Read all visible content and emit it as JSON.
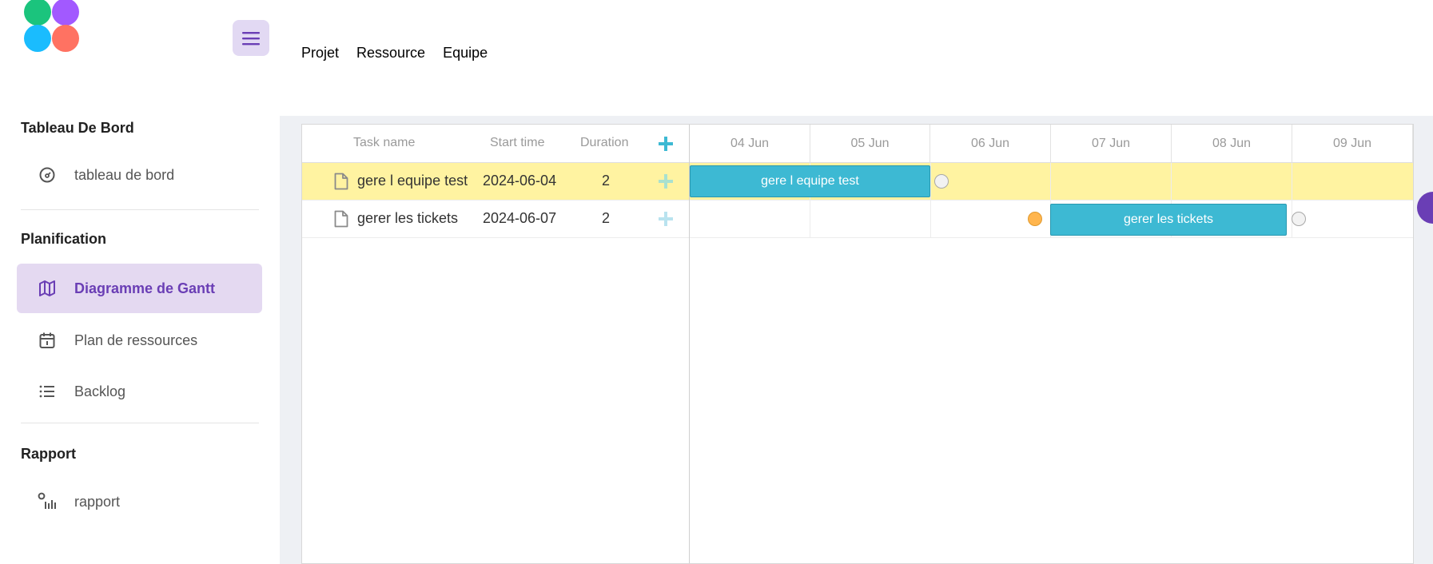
{
  "header": {
    "menu_icon": "hamburger-icon",
    "nav": [
      "Projet",
      "Ressource",
      "Equipe"
    ]
  },
  "sidebar": {
    "sections": [
      {
        "title": "Tableau De Bord",
        "items": [
          {
            "label": "tableau de bord",
            "icon": "dashboard-icon"
          }
        ]
      },
      {
        "title": "Planification",
        "items": [
          {
            "label": "Diagramme de Gantt",
            "icon": "map-icon",
            "active": true
          },
          {
            "label": "Plan de ressources",
            "icon": "calendar-icon"
          },
          {
            "label": "Backlog",
            "icon": "list-icon"
          }
        ]
      },
      {
        "title": "Rapport",
        "items": [
          {
            "label": "rapport",
            "icon": "report-icon"
          }
        ]
      }
    ]
  },
  "gantt": {
    "columns": {
      "task": "Task name",
      "start": "Start time",
      "duration": "Duration"
    },
    "scale": [
      "04 Jun",
      "05 Jun",
      "06 Jun",
      "07 Jun",
      "08 Jun",
      "09 Jun"
    ],
    "tasks": [
      {
        "name": "gere l equipe test",
        "start": "2024-06-04",
        "duration": "2",
        "selected": true
      },
      {
        "name": "gerer les tickets",
        "start": "2024-06-07",
        "duration": "2",
        "selected": false
      }
    ],
    "colors": {
      "bar": "#3db9d3",
      "highlight": "#fff3a1",
      "plus": "#3db9d3",
      "accent": "#6a3eb5"
    }
  }
}
